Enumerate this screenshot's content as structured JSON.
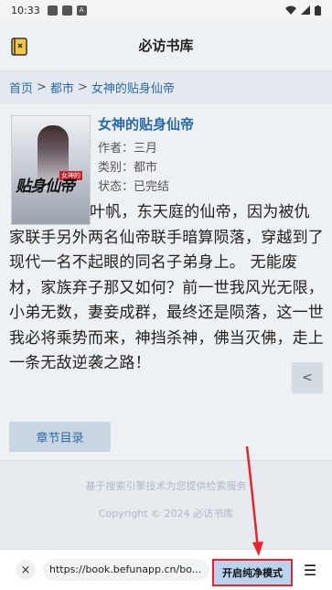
{
  "status_bar": {
    "time": "10:33"
  },
  "header": {
    "title": "必访书库"
  },
  "breadcrumb": {
    "home": "首页",
    "category": "都市",
    "book": "女神的贴身仙帝",
    "sep": ">"
  },
  "book": {
    "cover_title": "贴身仙帝",
    "title": "女神的贴身仙帝",
    "author": "作者：三月",
    "category": "类别：都市",
    "status": "状态：已完结",
    "description": "叶帆，东天庭的仙帝，因为被仇家联手另外两名仙帝联手暗算陨落，穿越到了现代一名不起眼的同名子弟身上。 无能废材，家族弃子那又如何？前一世我风光无限，小弟无数，妻妾成群，最终还是陨落，这一世我必将乘势而来，神挡杀神，佛当灭佛，走上一条无敌逆袭之路！",
    "chapter_button": "章节目录"
  },
  "footer": {
    "line1": "基于搜索引擎技术为您提供检索服务",
    "line2": "Copyright © 2024 必访书库"
  },
  "browser_bar": {
    "url": "https://book.befunapp.cn/bo...",
    "pure_mode_button": "开启纯净模式",
    "close_icon": "×",
    "menu_icon": "☰"
  },
  "colors": {
    "accent": "#2a6aa8",
    "highlight_border": "#e8242a"
  }
}
